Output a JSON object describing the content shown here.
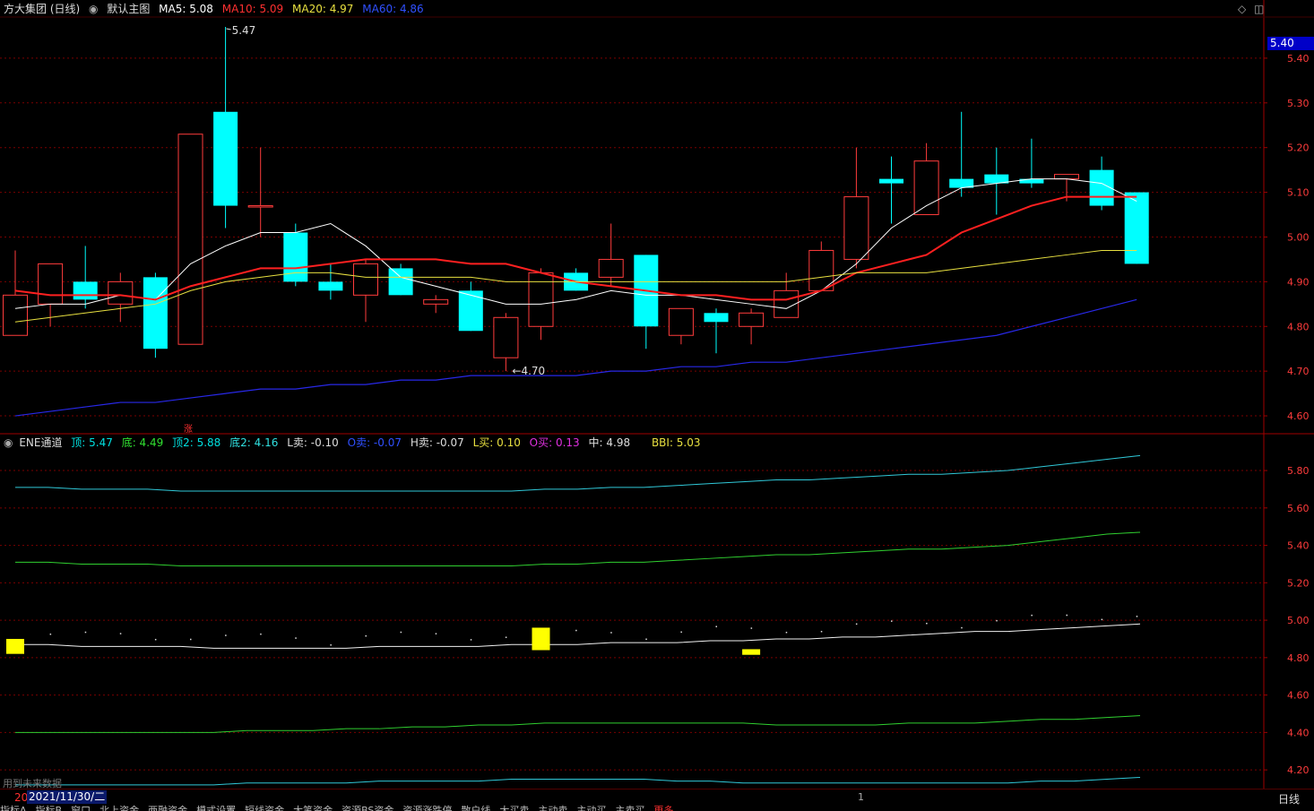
{
  "header": {
    "stock_title": "方大集团 (日线)",
    "theme_label": "默认主图",
    "ma5": "MA5: 5.08",
    "ma10": "MA10: 5.09",
    "ma20": "MA20: 4.97",
    "ma60": "MA60: 4.86"
  },
  "sub_header": {
    "indicator": "ENE通道",
    "top": "顶: 5.47",
    "bottom": "底: 4.49",
    "top2": "顶2: 5.88",
    "bottom2": "底2: 4.16",
    "l_sell": "L卖: -0.10",
    "o_sell": "O卖: -0.07",
    "h_sell": "H卖: -0.07",
    "l_buy": "L买: 0.10",
    "o_buy": "O买: 0.13",
    "mid": "中: 4.98",
    "bbi": "BBI: 5.03"
  },
  "current_price_tag": "5.40",
  "rise_marker": "涨",
  "future_note": "用到未来数据",
  "date_prefix": "20",
  "date_label": "2021/11/30/二",
  "bottom_tick": "1",
  "cycle_label": "日线",
  "tabs": [
    "指标A",
    "指标B",
    "窗口",
    "北上资金",
    "两融资金",
    "模式设置",
    "短线资金",
    "大笔资金",
    "资源BS资金",
    "资源涨跌停",
    "散户线",
    "大买卖",
    "主动卖",
    "主动买",
    "主卖买",
    "更多"
  ],
  "colors": {
    "up": "#ff3c3c",
    "down": "#00ffff",
    "ma5": "#ffffff",
    "ma10": "#ff2020",
    "ma20": "#e8e040",
    "ma60": "#2828e8",
    "grid": "#7a0000",
    "axis": "#a00000"
  },
  "chart_data": [
    {
      "type": "candlestick",
      "title": "方大集团 (日线)",
      "ylim": [
        4.56,
        5.48
      ],
      "yticks": [
        "5.40",
        "5.30",
        "5.20",
        "5.10",
        "5.00",
        "4.90",
        "4.80",
        "4.70",
        "4.60"
      ],
      "annotations": [
        {
          "text": "5.47",
          "index": 6,
          "value": 5.47
        },
        {
          "text": "←4.70",
          "index": 14,
          "value": 4.7
        }
      ],
      "candles": [
        {
          "o": 4.78,
          "h": 4.97,
          "l": 4.78,
          "c": 4.87
        },
        {
          "o": 4.85,
          "h": 4.94,
          "l": 4.8,
          "c": 4.94
        },
        {
          "o": 4.9,
          "h": 4.98,
          "l": 4.84,
          "c": 4.86
        },
        {
          "o": 4.85,
          "h": 4.92,
          "l": 4.81,
          "c": 4.9
        },
        {
          "o": 4.91,
          "h": 4.92,
          "l": 4.73,
          "c": 4.75
        },
        {
          "o": 4.76,
          "h": 5.23,
          "l": 4.76,
          "c": 5.23
        },
        {
          "o": 5.28,
          "h": 5.47,
          "l": 5.02,
          "c": 5.07
        },
        {
          "o": 5.07,
          "h": 5.2,
          "l": 5.0,
          "c": 5.07
        },
        {
          "o": 5.01,
          "h": 5.03,
          "l": 4.89,
          "c": 4.9
        },
        {
          "o": 4.9,
          "h": 4.94,
          "l": 4.86,
          "c": 4.88
        },
        {
          "o": 4.87,
          "h": 4.95,
          "l": 4.81,
          "c": 4.94
        },
        {
          "o": 4.93,
          "h": 4.94,
          "l": 4.87,
          "c": 4.87
        },
        {
          "o": 4.85,
          "h": 4.87,
          "l": 4.83,
          "c": 4.86
        },
        {
          "o": 4.88,
          "h": 4.9,
          "l": 4.79,
          "c": 4.79
        },
        {
          "o": 4.73,
          "h": 4.83,
          "l": 4.7,
          "c": 4.82
        },
        {
          "o": 4.8,
          "h": 4.93,
          "l": 4.77,
          "c": 4.92
        },
        {
          "o": 4.92,
          "h": 4.93,
          "l": 4.88,
          "c": 4.88
        },
        {
          "o": 4.91,
          "h": 5.03,
          "l": 4.89,
          "c": 4.95
        },
        {
          "o": 4.96,
          "h": 4.96,
          "l": 4.75,
          "c": 4.8
        },
        {
          "o": 4.78,
          "h": 4.84,
          "l": 4.76,
          "c": 4.84
        },
        {
          "o": 4.83,
          "h": 4.84,
          "l": 4.74,
          "c": 4.81
        },
        {
          "o": 4.8,
          "h": 4.84,
          "l": 4.76,
          "c": 4.83
        },
        {
          "o": 4.82,
          "h": 4.92,
          "l": 4.82,
          "c": 4.88
        },
        {
          "o": 4.88,
          "h": 4.99,
          "l": 4.88,
          "c": 4.97
        },
        {
          "o": 4.95,
          "h": 5.2,
          "l": 4.93,
          "c": 5.09
        },
        {
          "o": 5.13,
          "h": 5.18,
          "l": 5.03,
          "c": 5.12
        },
        {
          "o": 5.05,
          "h": 5.21,
          "l": 5.05,
          "c": 5.17
        },
        {
          "o": 5.13,
          "h": 5.28,
          "l": 5.09,
          "c": 5.11
        },
        {
          "o": 5.14,
          "h": 5.2,
          "l": 5.05,
          "c": 5.12
        },
        {
          "o": 5.13,
          "h": 5.22,
          "l": 5.11,
          "c": 5.12
        },
        {
          "o": 5.13,
          "h": 5.14,
          "l": 5.08,
          "c": 5.14
        },
        {
          "o": 5.15,
          "h": 5.18,
          "l": 5.06,
          "c": 5.07
        },
        {
          "o": 5.1,
          "h": 5.1,
          "l": 4.94,
          "c": 4.94
        }
      ],
      "series": [
        {
          "name": "MA5",
          "values": [
            4.84,
            4.85,
            4.85,
            4.87,
            4.86,
            4.94,
            4.98,
            5.01,
            5.01,
            5.03,
            4.98,
            4.91,
            4.89,
            4.87,
            4.85,
            4.85,
            4.86,
            4.88,
            4.87,
            4.87,
            4.86,
            4.85,
            4.84,
            4.88,
            4.94,
            5.02,
            5.07,
            5.11,
            5.12,
            5.13,
            5.13,
            5.12,
            5.08
          ]
        },
        {
          "name": "MA10",
          "values": [
            4.88,
            4.87,
            4.87,
            4.87,
            4.86,
            4.89,
            4.91,
            4.93,
            4.93,
            4.94,
            4.95,
            4.95,
            4.95,
            4.94,
            4.94,
            4.92,
            4.9,
            4.89,
            4.88,
            4.87,
            4.87,
            4.86,
            4.86,
            4.88,
            4.92,
            4.94,
            4.96,
            5.01,
            5.04,
            5.07,
            5.09,
            5.09,
            5.09
          ]
        },
        {
          "name": "MA20",
          "values": [
            4.81,
            4.82,
            4.83,
            4.84,
            4.85,
            4.88,
            4.9,
            4.91,
            4.92,
            4.92,
            4.91,
            4.91,
            4.91,
            4.91,
            4.9,
            4.9,
            4.9,
            4.9,
            4.9,
            4.9,
            4.9,
            4.9,
            4.9,
            4.91,
            4.92,
            4.92,
            4.92,
            4.93,
            4.94,
            4.95,
            4.96,
            4.97,
            4.97
          ]
        },
        {
          "name": "MA60",
          "values": [
            4.6,
            4.61,
            4.62,
            4.63,
            4.63,
            4.64,
            4.65,
            4.66,
            4.66,
            4.67,
            4.67,
            4.68,
            4.68,
            4.69,
            4.69,
            4.69,
            4.69,
            4.7,
            4.7,
            4.71,
            4.71,
            4.72,
            4.72,
            4.73,
            4.74,
            4.75,
            4.76,
            4.77,
            4.78,
            4.8,
            4.82,
            4.84,
            4.86
          ]
        }
      ]
    },
    {
      "type": "line",
      "title": "ENE通道",
      "ylim": [
        4.1,
        5.92
      ],
      "yticks": [
        "5.80",
        "5.60",
        "5.40",
        "5.20",
        "5.00",
        "4.80",
        "4.60",
        "4.40",
        "4.20"
      ],
      "series": [
        {
          "name": "顶2",
          "values": [
            5.71,
            5.71,
            5.7,
            5.7,
            5.7,
            5.69,
            5.69,
            5.69,
            5.69,
            5.69,
            5.69,
            5.69,
            5.69,
            5.69,
            5.69,
            5.69,
            5.7,
            5.7,
            5.71,
            5.71,
            5.72,
            5.73,
            5.74,
            5.75,
            5.75,
            5.76,
            5.77,
            5.78,
            5.78,
            5.79,
            5.8,
            5.82,
            5.84,
            5.86,
            5.88
          ]
        },
        {
          "name": "顶",
          "values": [
            5.31,
            5.31,
            5.3,
            5.3,
            5.3,
            5.29,
            5.29,
            5.29,
            5.29,
            5.29,
            5.29,
            5.29,
            5.29,
            5.29,
            5.29,
            5.29,
            5.3,
            5.3,
            5.31,
            5.31,
            5.32,
            5.33,
            5.34,
            5.35,
            5.35,
            5.36,
            5.37,
            5.38,
            5.38,
            5.39,
            5.4,
            5.42,
            5.44,
            5.46,
            5.47
          ]
        },
        {
          "name": "中",
          "values": [
            4.87,
            4.87,
            4.86,
            4.86,
            4.86,
            4.86,
            4.85,
            4.85,
            4.85,
            4.85,
            4.85,
            4.86,
            4.86,
            4.86,
            4.86,
            4.87,
            4.87,
            4.87,
            4.88,
            4.88,
            4.88,
            4.89,
            4.89,
            4.9,
            4.9,
            4.91,
            4.91,
            4.92,
            4.93,
            4.94,
            4.94,
            4.95,
            4.96,
            4.97,
            4.98
          ]
        },
        {
          "name": "底",
          "values": [
            4.4,
            4.4,
            4.4,
            4.4,
            4.4,
            4.4,
            4.4,
            4.41,
            4.41,
            4.41,
            4.42,
            4.42,
            4.43,
            4.43,
            4.44,
            4.44,
            4.45,
            4.45,
            4.45,
            4.45,
            4.45,
            4.45,
            4.45,
            4.44,
            4.44,
            4.44,
            4.44,
            4.45,
            4.45,
            4.45,
            4.46,
            4.47,
            4.47,
            4.48,
            4.49
          ]
        },
        {
          "name": "底2",
          "values": [
            4.12,
            4.12,
            4.12,
            4.12,
            4.12,
            4.12,
            4.12,
            4.13,
            4.13,
            4.13,
            4.13,
            4.14,
            4.14,
            4.14,
            4.14,
            4.15,
            4.15,
            4.15,
            4.15,
            4.15,
            4.14,
            4.14,
            4.13,
            4.13,
            4.13,
            4.13,
            4.13,
            4.13,
            4.13,
            4.13,
            4.13,
            4.14,
            4.14,
            4.15,
            4.16
          ]
        }
      ],
      "signals": [
        {
          "index": 0,
          "value": 4.86,
          "height": 0.08
        },
        {
          "index": 15,
          "value": 4.9,
          "height": 0.12
        },
        {
          "index": 21,
          "value": 4.83,
          "height": 0.03
        }
      ]
    }
  ]
}
